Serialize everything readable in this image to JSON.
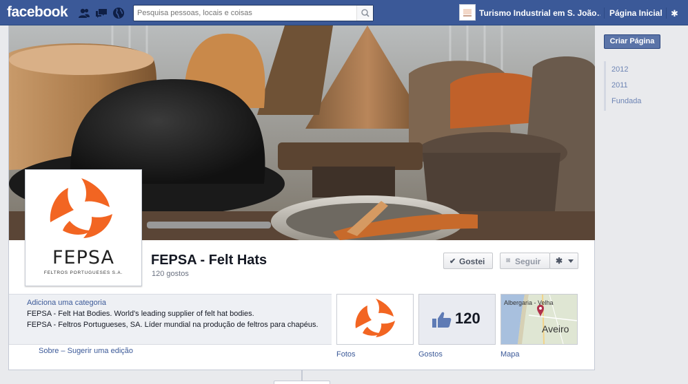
{
  "topbar": {
    "logo": "facebook",
    "search_placeholder": "Pesquisa pessoas, locais e coisas",
    "page_name": "Turismo Industrial em S. João…",
    "home_label": "Página Inicial"
  },
  "page": {
    "title": "FEPSA - Felt Hats",
    "likes_text": "120 gostos",
    "logo_word": "FEPSA",
    "logo_subtitle": "FELTROS PORTUGUESES S.A.",
    "liked_label": "Gostei",
    "follow_label": "Seguir"
  },
  "about": {
    "add_category": "Adiciona uma categoria",
    "line1": "FEPSA - Felt Hat Bodies. World's leading supplier of felt hat bodies.",
    "line2": "FEPSA - Feltros Portugueses, SA. Líder mundial na produção de feltros para chapéus.",
    "about_link": "Sobre",
    "suggest_link": "Sugerir uma edição"
  },
  "tiles": {
    "photos_label": "Fotos",
    "likes_label": "Gostos",
    "likes_count": "120",
    "map_label": "Mapa",
    "map_town": "Albergaria - Velha",
    "map_city": "Aveiro"
  },
  "rail": {
    "create_page": "Criar Página",
    "years": [
      "2012",
      "2011",
      "Fundada"
    ]
  },
  "colors": {
    "brand_blue": "#3b5998",
    "fepsa_orange": "#f26522"
  }
}
